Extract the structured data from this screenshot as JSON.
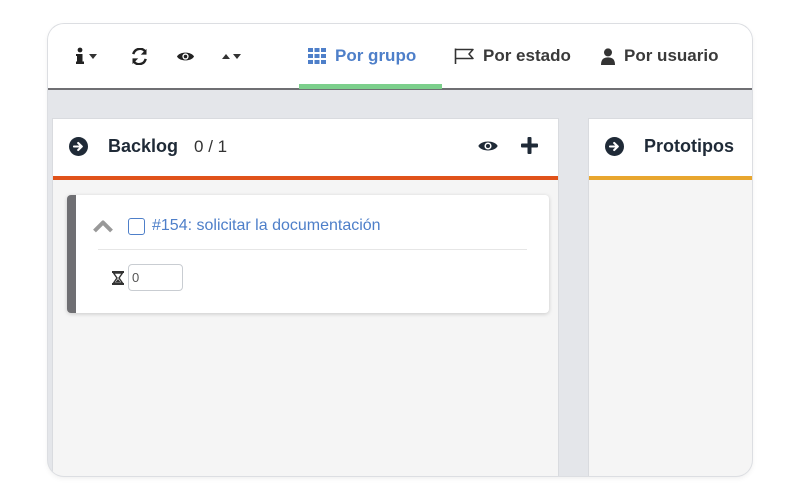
{
  "toolbar": {
    "icons": {
      "info": "info-icon",
      "refresh": "refresh-icon",
      "view": "eye-icon",
      "sort": "sort-icon"
    },
    "tabs": [
      {
        "label": "Por grupo",
        "icon": "grid-icon",
        "active": true
      },
      {
        "label": "Por estado",
        "icon": "flag-icon",
        "active": false
      },
      {
        "label": "Por usuario",
        "icon": "user-icon",
        "active": false
      }
    ]
  },
  "columns": [
    {
      "title": "Backlog",
      "count": "0 / 1",
      "accent": "#e0521a",
      "cards": [
        {
          "title": "#154: solicitar la documentación",
          "estimate": "0"
        }
      ]
    },
    {
      "title": "Prototipos",
      "accent": "#e8a62e"
    }
  ],
  "colors": {
    "active_tab": "#4e7fc9",
    "tab_underline": "#7ccf8c",
    "card_border": "#6f6f73"
  }
}
